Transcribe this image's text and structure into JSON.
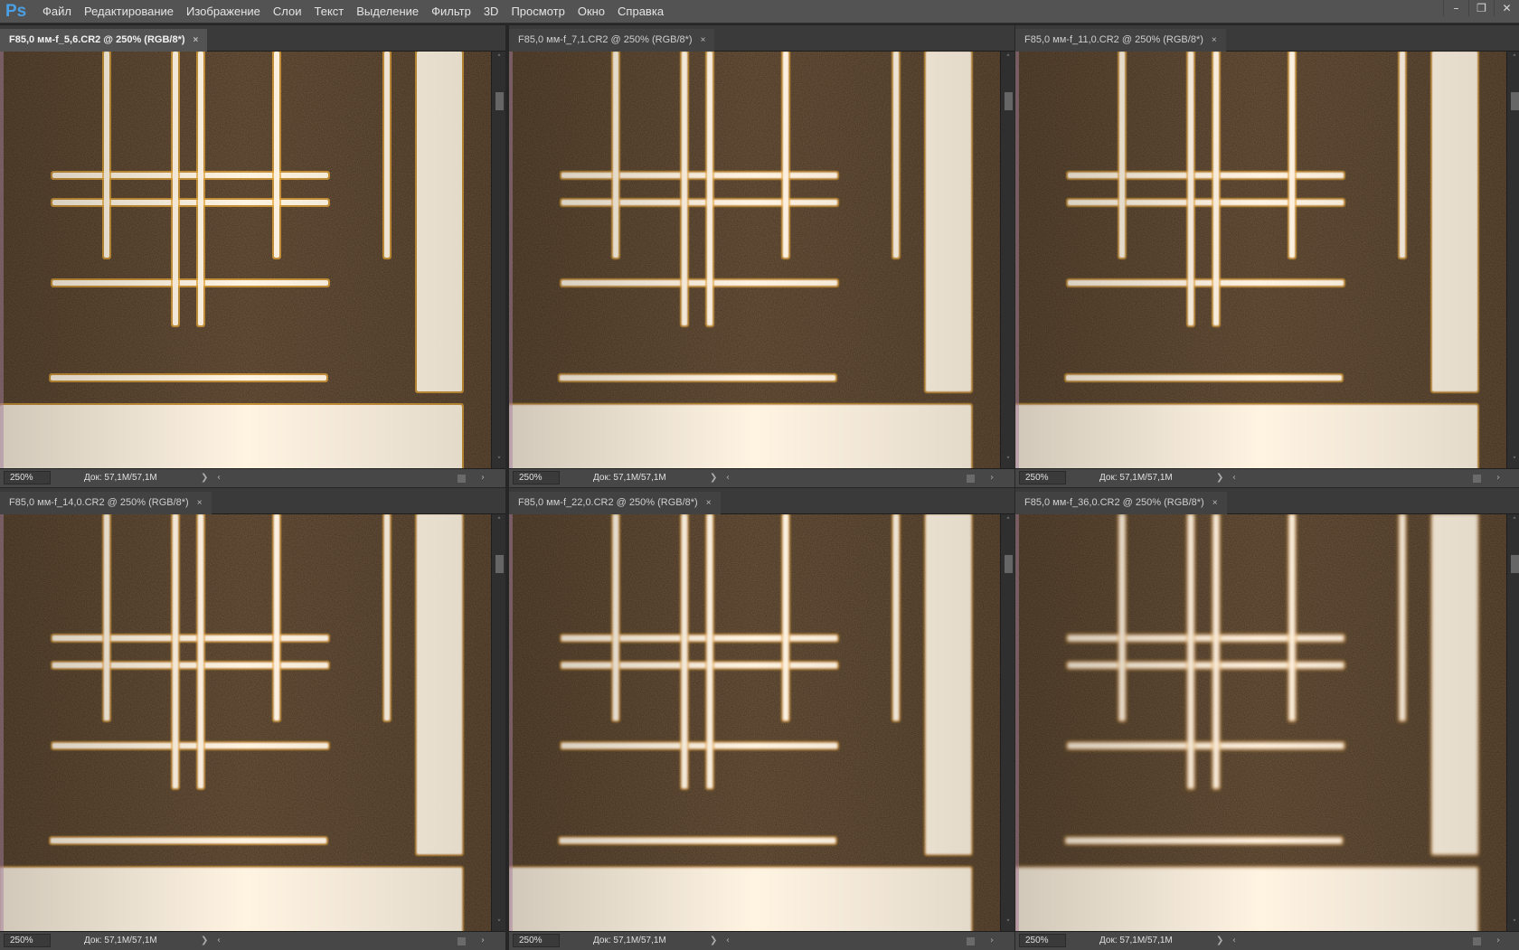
{
  "app": {
    "logo": "Ps",
    "menu": [
      "Файл",
      "Редактирование",
      "Изображение",
      "Слои",
      "Текст",
      "Выделение",
      "Фильтр",
      "3D",
      "Просмотр",
      "Окно",
      "Справка"
    ],
    "window_controls": [
      "–",
      "❐",
      "✕"
    ]
  },
  "documents": [
    {
      "tab": "F85,0 мм-f_5,6.CR2 @ 250% (RGB/8*)",
      "close": "×",
      "zoom": "250%",
      "doc": "Док: 57,1M/57,1M",
      "active": true,
      "blur": 0.3
    },
    {
      "tab": "F85,0 мм-f_7,1.CR2 @ 250% (RGB/8*)",
      "close": "×",
      "zoom": "250%",
      "doc": "Док: 57,1M/57,1M",
      "active": false,
      "blur": 0.4
    },
    {
      "tab": "F85,0 мм-f_11,0.CR2 @ 250% (RGB/8*)",
      "close": "×",
      "zoom": "250%",
      "doc": "Док: 57,1M/57,1M",
      "active": false,
      "blur": 0.6
    },
    {
      "tab": "F85,0 мм-f_14,0.CR2 @ 250% (RGB/8*)",
      "close": "×",
      "zoom": "250%",
      "doc": "Док: 57,1M/57,1M",
      "active": false,
      "blur": 0.8
    },
    {
      "tab": "F85,0 мм-f_22,0.CR2 @ 250% (RGB/8*)",
      "close": "×",
      "zoom": "250%",
      "doc": "Док: 57,1M/57,1M",
      "active": false,
      "blur": 1.1
    },
    {
      "tab": "F85,0 мм-f_36,0.CR2 @ 250% (RGB/8*)",
      "close": "×",
      "zoom": "250%",
      "doc": "Док: 57,1M/57,1M",
      "active": false,
      "blur": 1.8
    }
  ],
  "colors": {
    "background": "#46321e",
    "line": "#fff4e2",
    "edge_warm": "#e8a838",
    "edge_cool": "#c89ac0"
  }
}
